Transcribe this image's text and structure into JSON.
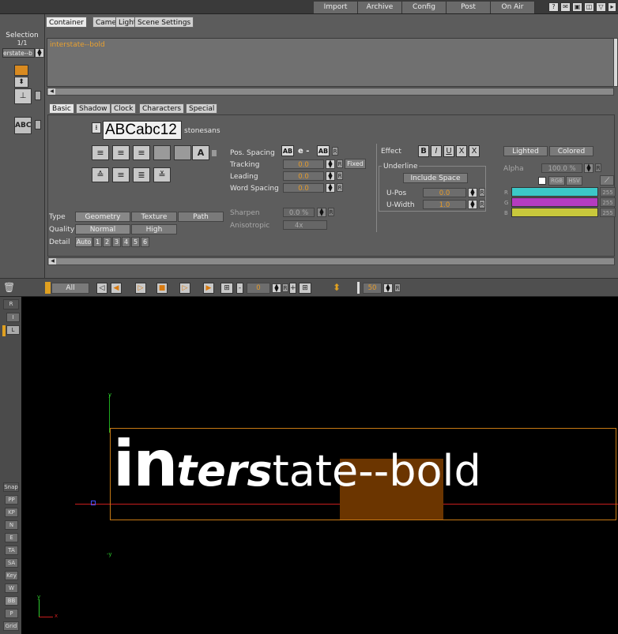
{
  "topbar": {
    "buttons": [
      "Import",
      "Archive",
      "Config",
      "Post",
      "On Air"
    ]
  },
  "left": {
    "selection_label": "Selection",
    "count": "1/1",
    "item": "erstate--b"
  },
  "tabs": [
    "Container",
    "Camera",
    "Light",
    "Scene Settings"
  ],
  "text_value": "interstate--bold",
  "subtabs": [
    "Basic",
    "Shadow",
    "Clock",
    "Characters",
    "Special"
  ],
  "font": {
    "preview": "ABCabc12",
    "name": "stonesans"
  },
  "spacing": {
    "pos_spacing": "Pos. Spacing",
    "tracking": "Tracking",
    "tracking_val": "0.0",
    "leading": "Leading",
    "leading_val": "0.0",
    "word_spacing": "Word Spacing",
    "word_val": "0.0",
    "fixed": "Fixed",
    "sharpen": "Sharpen",
    "sharpen_val": "0.0 %",
    "anisotropic": "Anisotropic",
    "aniso_val": "4x"
  },
  "type": {
    "label": "Type",
    "options": [
      "Geometry",
      "Texture",
      "Path"
    ]
  },
  "quality": {
    "label": "Quality",
    "options": [
      "Normal",
      "High"
    ]
  },
  "detail": {
    "label": "Detail",
    "options": [
      "Auto",
      "1",
      "2",
      "3",
      "4",
      "5",
      "6"
    ]
  },
  "effect": {
    "label": "Effect",
    "buttons": [
      "B",
      "I",
      "U",
      "X",
      "X"
    ],
    "underline": "Underline",
    "include_space": "Include Space",
    "upos": "U-Pos",
    "upos_val": "0.0",
    "uwidth": "U-Width",
    "uwidth_val": "1.0"
  },
  "material": {
    "lighted": "Lighted",
    "colored": "Colored",
    "alpha": "Alpha",
    "alpha_val": "100.0 %",
    "rgb": "RGB",
    "hsv": "HSV",
    "channels": [
      {
        "name": "R",
        "value": "255",
        "color": "#3cc8c8"
      },
      {
        "name": "G",
        "value": "255",
        "color": "#b43cc0"
      },
      {
        "name": "B",
        "value": "255",
        "color": "#c8c83c"
      }
    ]
  },
  "timeline": {
    "all": "All",
    "frame": "0",
    "end": "50"
  },
  "side_buttons": [
    "Snap",
    "PP",
    "KP",
    "N",
    "E",
    "TA",
    "SA",
    "Key",
    "W",
    "BB",
    "P",
    "Grid"
  ],
  "scene": {
    "text_a": "in",
    "text_b": "ters",
    "text_c": "tate--bold",
    "y_label": "y",
    "neg_y_label": "-y",
    "x_label": "x"
  }
}
